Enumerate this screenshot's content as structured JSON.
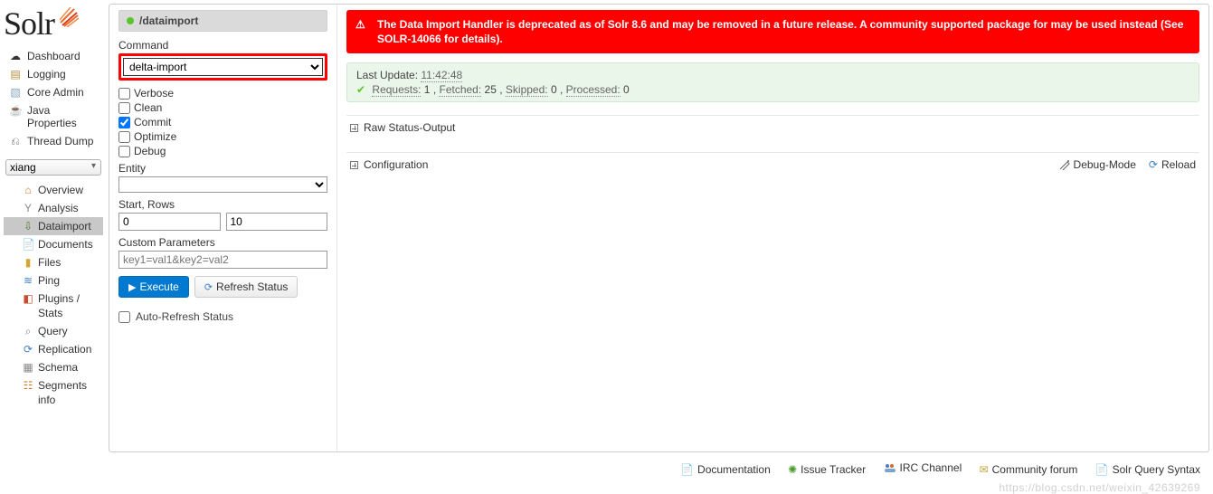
{
  "logo": {
    "text": "Solr"
  },
  "nav": {
    "items": [
      {
        "label": "Dashboard",
        "icon": "☁"
      },
      {
        "label": "Logging",
        "icon": "📄"
      },
      {
        "label": "Core Admin",
        "icon": "🗄"
      },
      {
        "label": "Java Properties",
        "icon": "📋"
      },
      {
        "label": "Thread Dump",
        "icon": "🧵"
      }
    ]
  },
  "core_selector": {
    "selected": "xiang"
  },
  "core_nav": {
    "items": [
      {
        "label": "Overview",
        "icon": "🏠"
      },
      {
        "label": "Analysis",
        "icon": "⌕"
      },
      {
        "label": "Dataimport",
        "icon": "📥",
        "selected": true
      },
      {
        "label": "Documents",
        "icon": "📄"
      },
      {
        "label": "Files",
        "icon": "📁"
      },
      {
        "label": "Ping",
        "icon": "📶"
      },
      {
        "label": "Plugins / Stats",
        "icon": "🧩"
      },
      {
        "label": "Query",
        "icon": "🔍"
      },
      {
        "label": "Replication",
        "icon": "🔁"
      },
      {
        "label": "Schema",
        "icon": "▦"
      },
      {
        "label": "Segments info",
        "icon": "📊"
      }
    ]
  },
  "form": {
    "header_title": "/dataimport",
    "command_label": "Command",
    "command_value": "delta-import",
    "checkbox_labels": {
      "verbose": "Verbose",
      "clean": "Clean",
      "commit": "Commit",
      "optimize": "Optimize",
      "debug": "Debug"
    },
    "checkbox_state": {
      "verbose": false,
      "clean": false,
      "commit": true,
      "optimize": false,
      "debug": false
    },
    "entity_label": "Entity",
    "startrows_label": "Start, Rows",
    "start_value": "0",
    "rows_value": "10",
    "custom_label": "Custom Parameters",
    "custom_placeholder": "key1=val1&key2=val2",
    "execute_label": "Execute",
    "refresh_label": "Refresh Status",
    "auto_refresh_label": "Auto-Refresh Status"
  },
  "alert": {
    "text": "The Data Import Handler is deprecated as of Solr 8.6 and may be removed in a future release. A community supported package for may be used instead (See SOLR-14066 for details)."
  },
  "status": {
    "last_update_label": "Last Update:",
    "last_update_value": "11:42:48",
    "requests_label": "Requests:",
    "requests_value": "1",
    "fetched_label": "Fetched:",
    "fetched_value": "25",
    "skipped_label": "Skipped:",
    "skipped_value": "0",
    "processed_label": "Processed:",
    "processed_value": "0"
  },
  "expanders": {
    "raw_label": "Raw Status-Output",
    "config_label": "Configuration",
    "debug_mode_label": "Debug-Mode",
    "reload_label": "Reload"
  },
  "footer": {
    "doc": "Documentation",
    "issue": "Issue Tracker",
    "irc": "IRC Channel",
    "forum": "Community forum",
    "syntax": "Solr Query Syntax"
  },
  "watermark": "https://blog.csdn.net/weixin_42639269"
}
